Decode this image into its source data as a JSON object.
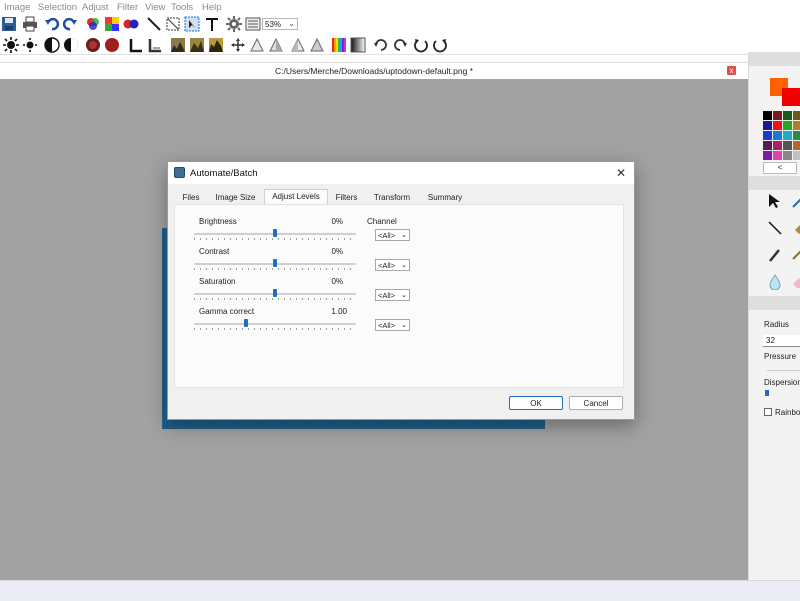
{
  "menu": [
    "Image",
    "Selection",
    "Adjust",
    "Filter",
    "View",
    "Tools",
    "Help"
  ],
  "toolbar": {
    "zoom": "53%"
  },
  "document": {
    "path": "C:/Users/Merche/Downloads/uptodown-default.png *",
    "close": "x"
  },
  "colors": {
    "primary": "#ff6000",
    "secondary": "#ee0000",
    "dialog_accent": "#1e6fbf",
    "canvas_bg": "#a2a2a2",
    "image": "#1f5f8d"
  },
  "right_panel": {
    "palette_nav": "<",
    "radius_label": "Radius",
    "radius_value": "32",
    "pressure_label": "Pressure",
    "dispersion_label": "Dispersion",
    "rainbow_label": "Rainbow"
  },
  "dialog": {
    "title": "Automate/Batch",
    "close": "✕",
    "tabs": [
      "Files",
      "Image Size",
      "Adjust Levels",
      "Filters",
      "Transform",
      "Summary"
    ],
    "active_tab": "Adjust Levels",
    "channel_label": "Channel",
    "sliders": [
      {
        "label": "Brightness",
        "value": "0%",
        "level": 0.5,
        "channel": "<All>"
      },
      {
        "label": "Contrast",
        "value": "0%",
        "level": 0.5,
        "channel": "<All>"
      },
      {
        "label": "Saturation",
        "value": "0%",
        "level": 0.5,
        "channel": "<All>"
      },
      {
        "label": "Gamma correct",
        "value": "1.00",
        "level": 0.32,
        "channel": "<All>"
      }
    ],
    "ok": "OK",
    "cancel": "Cancel"
  }
}
